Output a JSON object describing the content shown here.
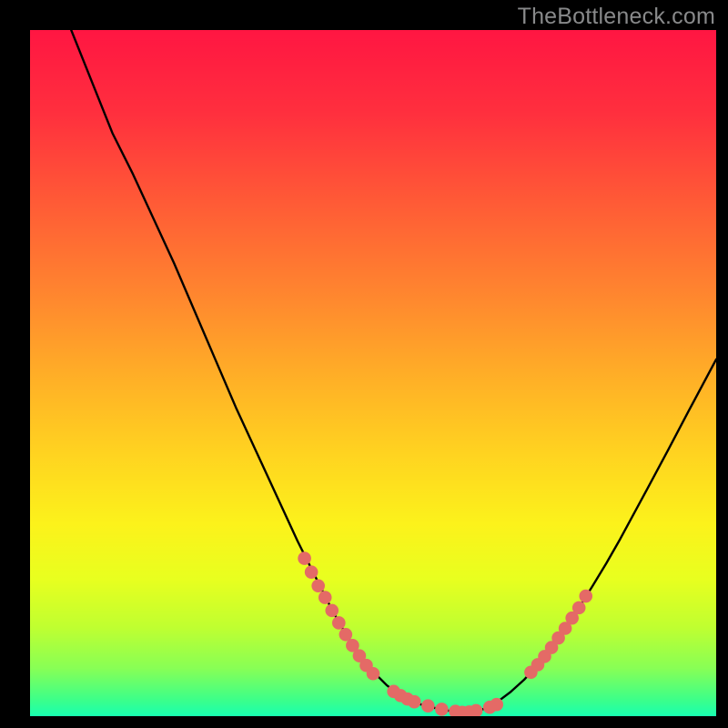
{
  "watermark": "TheBottleneck.com",
  "gradient": {
    "stops": [
      {
        "offset": 0.0,
        "color": "#ff1642"
      },
      {
        "offset": 0.12,
        "color": "#ff2f3e"
      },
      {
        "offset": 0.25,
        "color": "#ff5a36"
      },
      {
        "offset": 0.38,
        "color": "#ff842f"
      },
      {
        "offset": 0.5,
        "color": "#ffad27"
      },
      {
        "offset": 0.62,
        "color": "#ffd420"
      },
      {
        "offset": 0.72,
        "color": "#fcf21b"
      },
      {
        "offset": 0.8,
        "color": "#e8ff1f"
      },
      {
        "offset": 0.87,
        "color": "#c0ff30"
      },
      {
        "offset": 0.93,
        "color": "#88ff55"
      },
      {
        "offset": 0.975,
        "color": "#3eff88"
      },
      {
        "offset": 1.0,
        "color": "#18ffb0"
      }
    ]
  },
  "chart_data": {
    "type": "line",
    "title": "",
    "xlabel": "",
    "ylabel": "",
    "xlim": [
      0,
      100
    ],
    "ylim": [
      0,
      100
    ],
    "series": [
      {
        "name": "left-branch",
        "x": [
          6,
          8,
          10,
          12,
          15,
          18,
          21,
          24,
          27,
          30,
          33,
          36,
          39,
          42,
          44,
          46,
          48,
          50,
          52,
          54,
          55,
          57,
          59,
          61,
          63
        ],
        "y": [
          100,
          95,
          90,
          85,
          79,
          72.5,
          66,
          59,
          52,
          45,
          38.5,
          32,
          25.5,
          19.5,
          15.5,
          12,
          9,
          6.5,
          4.5,
          3,
          2.4,
          1.7,
          1.2,
          0.8,
          0.55
        ],
        "stroke": "#000000",
        "markers": false
      },
      {
        "name": "right-branch",
        "x": [
          63,
          66,
          68,
          70,
          72,
          74,
          76,
          78,
          80,
          82,
          84,
          86,
          88,
          90,
          93,
          96,
          100
        ],
        "y": [
          0.55,
          1.0,
          2.0,
          3.5,
          5.3,
          7.5,
          10.0,
          12.8,
          15.8,
          19.0,
          22.3,
          25.8,
          29.5,
          33.2,
          38.8,
          44.5,
          52
        ],
        "stroke": "#000000",
        "markers": false
      },
      {
        "name": "left-markers",
        "x": [
          40,
          41,
          42,
          43,
          44,
          45,
          46,
          47,
          48,
          49,
          50,
          53,
          54,
          55,
          56,
          58,
          60,
          62,
          63,
          64,
          65,
          67,
          68
        ],
        "y": [
          23,
          21,
          19,
          17.3,
          15.4,
          13.6,
          11.9,
          10.3,
          8.8,
          7.4,
          6.2,
          3.6,
          3.0,
          2.5,
          2.1,
          1.5,
          1.0,
          0.7,
          0.55,
          0.6,
          0.8,
          1.3,
          1.7
        ],
        "stroke": "none",
        "markers": true,
        "marker_color": "#e46a66"
      },
      {
        "name": "right-markers",
        "x": [
          73,
          74,
          75,
          76,
          77,
          78,
          79,
          80,
          81
        ],
        "y": [
          6.4,
          7.5,
          8.7,
          10.0,
          11.4,
          12.8,
          14.3,
          15.8,
          17.5
        ],
        "stroke": "none",
        "markers": true,
        "marker_color": "#e46a66"
      }
    ]
  }
}
